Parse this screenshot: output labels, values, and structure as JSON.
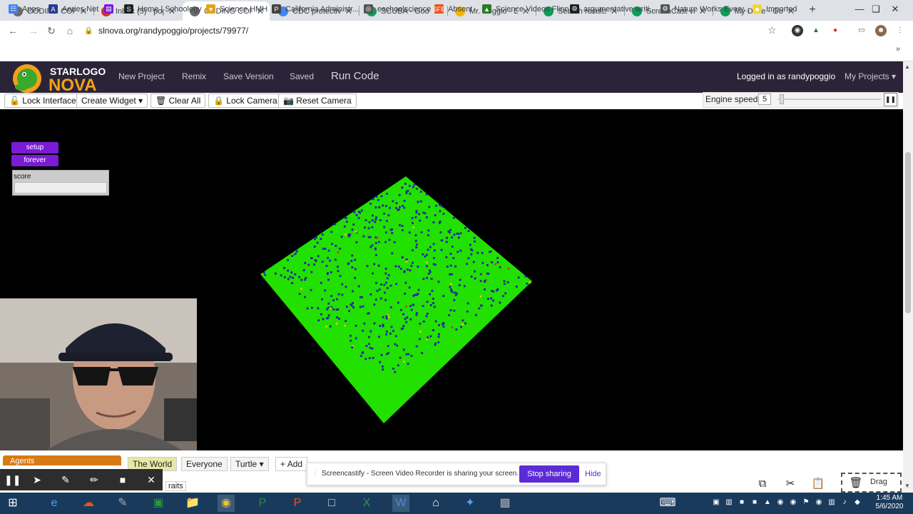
{
  "browser": {
    "tabs": [
      {
        "label": "CODING CORO",
        "fav": "starlogo-icon",
        "favcolor": "#6b6b6b"
      },
      {
        "label": "Inbox (5) - pog",
        "fav": "gmail-icon",
        "favcolor": "#d93025"
      },
      {
        "label": "CODING CORO",
        "fav": "starlogo-icon",
        "favcolor": "#6b6b6b",
        "active": true
      },
      {
        "label": "CDC protective",
        "fav": "google-icon",
        "favcolor": "#4285f4"
      },
      {
        "label": "SCUBA - Googl",
        "fav": "drive-icon",
        "favcolor": "#0f9d58"
      },
      {
        "label": "Mr. Poggio - D",
        "fav": "slides-icon",
        "favcolor": "#f4b400"
      },
      {
        "label": "Search results",
        "fav": "drive-icon",
        "favcolor": "#0f9d58"
      },
      {
        "label": "ScreenCast vide",
        "fav": "drive-icon",
        "favcolor": "#0f9d58"
      },
      {
        "label": "My Drive - Goo",
        "fav": "drive-icon",
        "favcolor": "#0f9d58"
      }
    ],
    "url": "slnova.org/randypoggio/projects/79977/",
    "bookmarks": [
      {
        "label": "Apps",
        "color": "#4285f4"
      },
      {
        "label": "Aeries.Net",
        "color": "#2a3b8f"
      },
      {
        "label": "",
        "color": "#7b1bd6"
      },
      {
        "label": "Home | Schoology",
        "color": "#222"
      },
      {
        "label": "Science HMH",
        "color": "#e3a21a"
      },
      {
        "label": "California Administr...",
        "color": "#444"
      },
      {
        "label": "eschoolscience",
        "color": "#555"
      },
      {
        "label": "Absent",
        "color": "#e8541a"
      },
      {
        "label": "Science Videos Flinn",
        "color": "#2a7a2a"
      },
      {
        "label": "argumentative writi...",
        "color": "#222"
      },
      {
        "label": "Nature Works Every...",
        "color": "#555"
      },
      {
        "label": "Imported",
        "color": "#f2d43a"
      }
    ]
  },
  "app": {
    "logo_top": "STARLOGO",
    "logo_bottom": "NOVA",
    "nav": [
      "New Project",
      "Remix",
      "Save Version",
      "Saved"
    ],
    "run_code": "Run Code",
    "logged_in": "Logged in as randypoggio",
    "my_projects": "My Projects"
  },
  "controls": {
    "lock_interface": "Lock Interface",
    "create_widget": "Create Widget",
    "clear_all": "Clear All",
    "lock_camera": "Lock Camera",
    "reset_camera": "Reset Camera",
    "engine_speed_label": "Engine speed",
    "engine_speed_value": "5"
  },
  "widgets": {
    "setup": "setup",
    "forever": "forever",
    "score_label": "score",
    "score_value": ""
  },
  "bottom": {
    "agents": "Agents",
    "the_world": "The World",
    "everyone": "Everyone",
    "turtle": "Turtle",
    "add_breed": "Add",
    "traits": "raits",
    "drag": "Drag"
  },
  "share": {
    "message": "Screencastify - Screen Video Recorder is sharing your screen.",
    "stop": "Stop sharing",
    "hide": "Hide"
  },
  "clock": {
    "time": "1:45 AM",
    "date": "5/6/2020"
  },
  "colors": {
    "terrain": "#22e000",
    "agents": "#2020a8",
    "brand_purple": "#7b1bd6",
    "app_bar": "#2b2438"
  }
}
